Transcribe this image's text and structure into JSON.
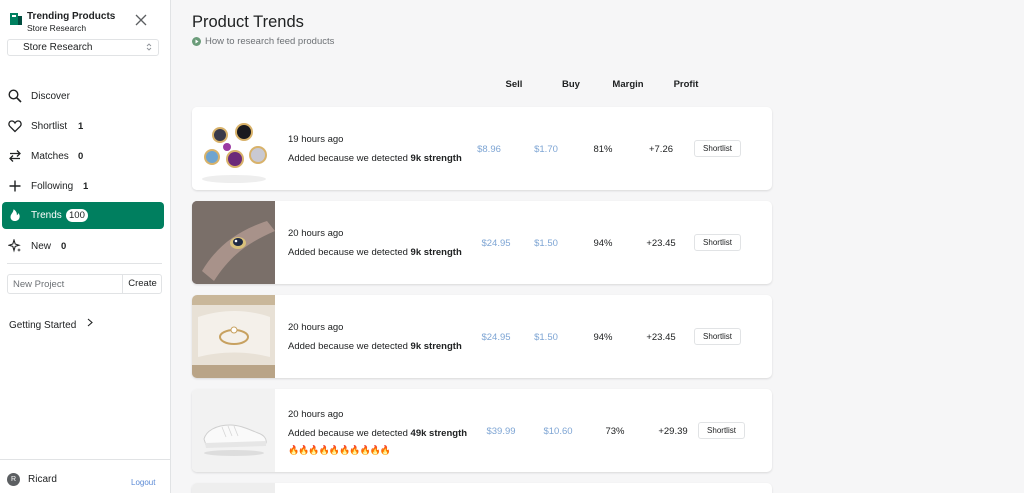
{
  "app": {
    "title": "Trending Products",
    "subtitle": "Store Research",
    "store_selected": "Store Research"
  },
  "nav": [
    {
      "label": "Discover",
      "count": "",
      "icon": "search-icon"
    },
    {
      "label": "Shortlist",
      "count": "1",
      "icon": "heart-icon"
    },
    {
      "label": "Matches",
      "count": "0",
      "icon": "swap-arrows-icon"
    },
    {
      "label": "Following",
      "count": "1",
      "icon": "plus-icon"
    },
    {
      "label": "Trends",
      "count": "100",
      "icon": "flame-icon",
      "active": true
    },
    {
      "label": "New",
      "count": "0",
      "icon": "sparkle-icon"
    }
  ],
  "new_project": {
    "placeholder": "New Project",
    "create_label": "Create"
  },
  "getting_started": "Getting Started",
  "user": {
    "name": "Ricard",
    "initial": "R",
    "logout": "Logout"
  },
  "page": {
    "title": "Product Trends",
    "help_link": "How to research feed products"
  },
  "columns": {
    "sell": "Sell",
    "buy": "Buy",
    "margin": "Margin",
    "profit": "Profit"
  },
  "products": [
    {
      "time": "19 hours ago",
      "reason_prefix": "Added because we detected ",
      "strength": "9k strength",
      "fires": "",
      "sell": "$8.96",
      "buy": "$1.70",
      "margin": "81%",
      "profit": "+7.26",
      "action": "Shortlist",
      "image": "gemstone-rings"
    },
    {
      "time": "20 hours ago",
      "reason_prefix": "Added because we detected ",
      "strength": "9k strength",
      "fires": "",
      "sell": "$24.95",
      "buy": "$1.50",
      "margin": "94%",
      "profit": "+23.45",
      "action": "Shortlist",
      "image": "ring-on-finger"
    },
    {
      "time": "20 hours ago",
      "reason_prefix": "Added because we detected ",
      "strength": "9k strength",
      "fires": "",
      "sell": "$24.95",
      "buy": "$1.50",
      "margin": "94%",
      "profit": "+23.45",
      "action": "Shortlist",
      "image": "ring-in-box"
    },
    {
      "time": "20 hours ago",
      "reason_prefix": "Added because we detected ",
      "strength": "49k strength",
      "fires": "🔥🔥🔥🔥🔥🔥🔥🔥🔥🔥",
      "sell": "$39.99",
      "buy": "$10.60",
      "margin": "73%",
      "profit": "+29.39",
      "action": "Shortlist",
      "image": "white-sneaker"
    }
  ],
  "colors": {
    "accent": "#007f5f",
    "price": "#7ea5d4",
    "link": "#5c8bd6"
  }
}
